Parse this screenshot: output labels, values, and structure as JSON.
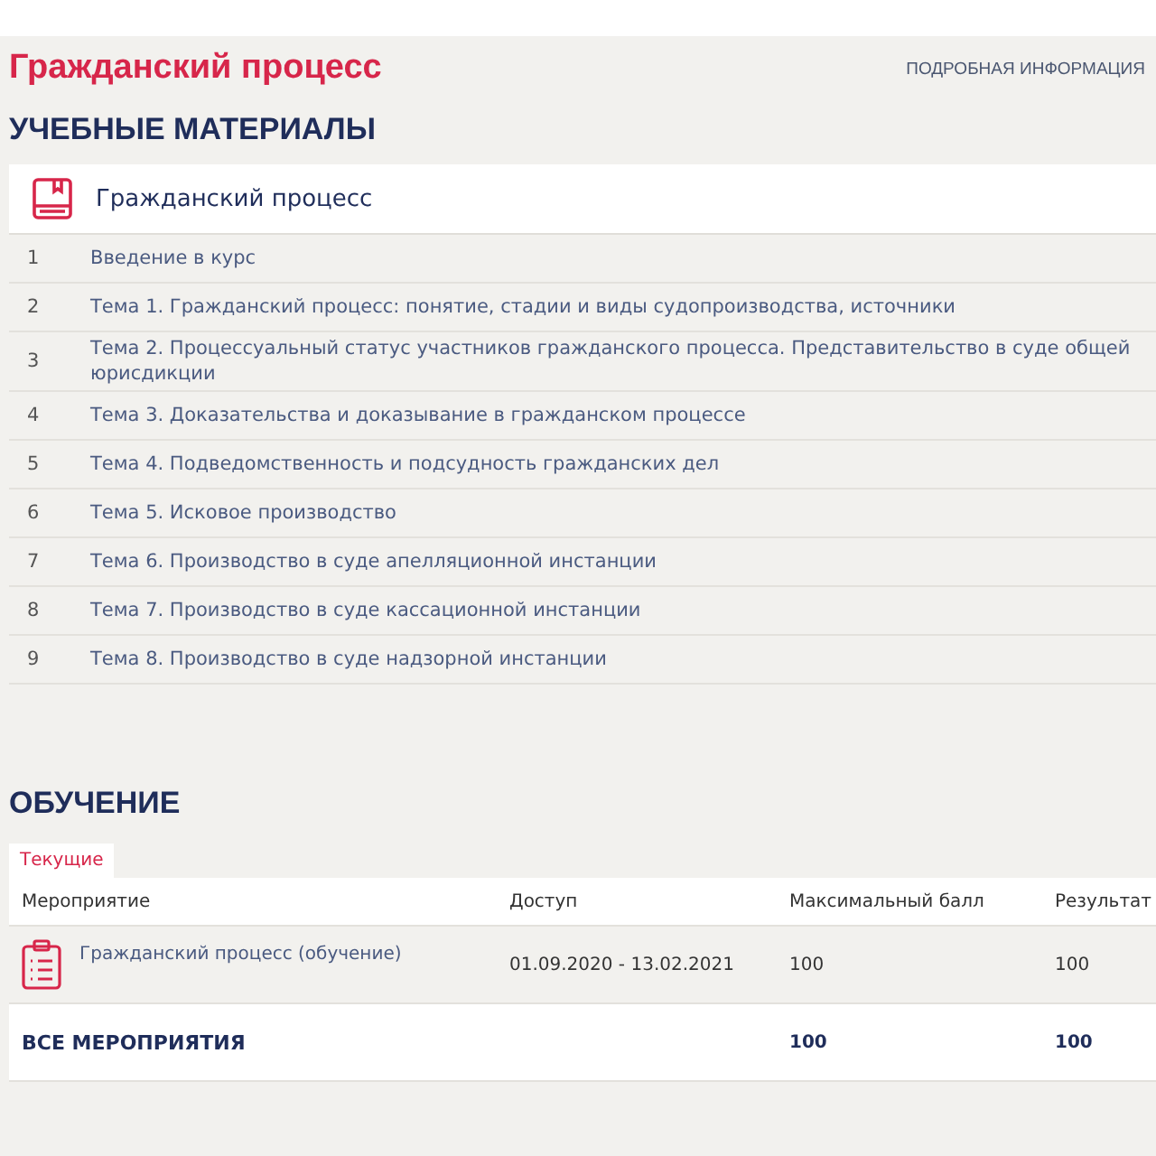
{
  "page_title": "Гражданский процесс",
  "info_link": "ПОДРОБНАЯ ИНФОРМАЦИЯ",
  "materials": {
    "heading": "УЧЕБНЫЕ МАТЕРИАЛЫ",
    "course": "Гражданский процесс",
    "items": [
      {
        "number": "1",
        "title": "Введение в курс"
      },
      {
        "number": "2",
        "title": "Тема 1. Гражданский процесс: понятие, стадии и виды судопроизводства, источники"
      },
      {
        "number": "3",
        "title": "Тема 2. Процессуальный статус участников гражданского процесса. Представительство в суде общей юрисдикции"
      },
      {
        "number": "4",
        "title": "Тема 3. Доказательства и доказывание в гражданском процессе"
      },
      {
        "number": "5",
        "title": "Тема 4. Подведомственность и подсудность гражданских дел"
      },
      {
        "number": "6",
        "title": "Тема 5. Исковое производство"
      },
      {
        "number": "7",
        "title": "Тема 6. Производство в суде апелляционной инстанции"
      },
      {
        "number": "8",
        "title": "Тема 7. Производство в суде кассационной инстанции"
      },
      {
        "number": "9",
        "title": "Тема 8. Производство в суде надзорной инстанции"
      }
    ]
  },
  "training": {
    "heading": "ОБУЧЕНИЕ",
    "tabs": [
      {
        "label": "Текущие",
        "selected": true
      }
    ],
    "columns": [
      "Мероприятие",
      "Доступ",
      "Максимальный балл",
      "Результат"
    ],
    "rows": [
      {
        "event": "Гражданский процесс (обучение)",
        "access": "01.09.2020 - 13.02.2021",
        "max_score": "100",
        "result": "100"
      }
    ],
    "total": {
      "label": "ВСЕ МЕРОПРИЯТИЯ",
      "max_score": "100",
      "result": "100"
    }
  }
}
